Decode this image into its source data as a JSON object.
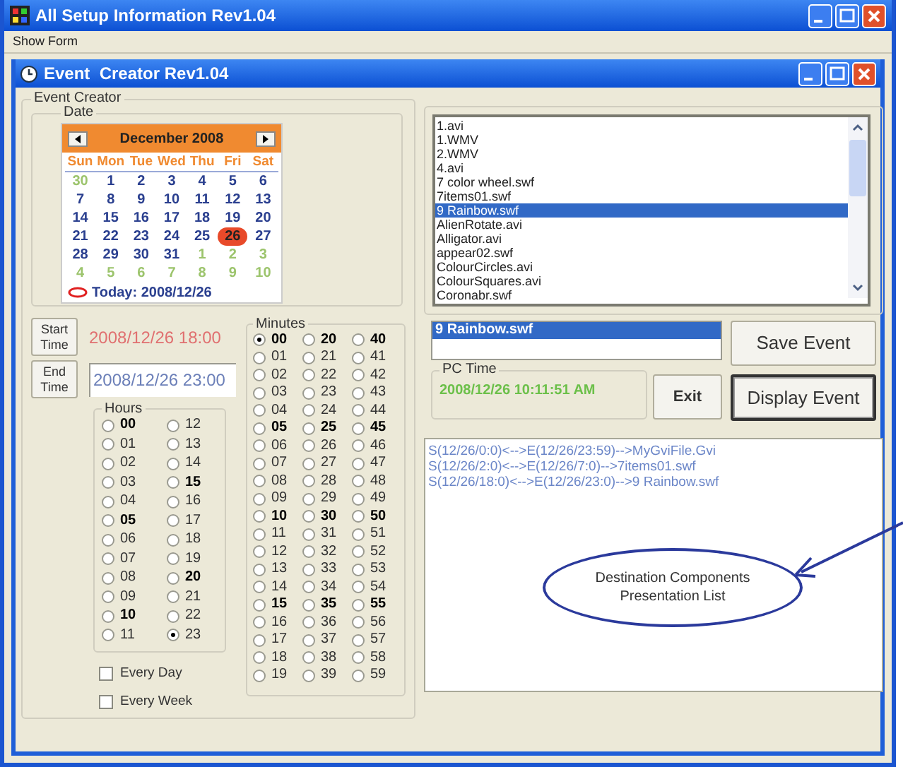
{
  "app_window": {
    "title": "All Setup Information Rev1.04",
    "menu": [
      {
        "label": "Show Form"
      }
    ]
  },
  "event_window": {
    "title": "Event  Creator Rev1.04"
  },
  "event_creator": {
    "legend": "Event Creator",
    "date_legend": "Date",
    "calendar": {
      "month": "December 2008",
      "weekdays": [
        "Sun",
        "Mon",
        "Tue",
        "Wed",
        "Thu",
        "Fri",
        "Sat"
      ],
      "weeks": [
        [
          {
            "day": "30",
            "kind": "other",
            "selected": false
          },
          {
            "day": "1",
            "kind": "current",
            "selected": false
          },
          {
            "day": "2",
            "kind": "current",
            "selected": false
          },
          {
            "day": "3",
            "kind": "current",
            "selected": false
          },
          {
            "day": "4",
            "kind": "current",
            "selected": false
          },
          {
            "day": "5",
            "kind": "current",
            "selected": false
          },
          {
            "day": "6",
            "kind": "current",
            "selected": false
          }
        ],
        [
          {
            "day": "7",
            "kind": "current",
            "selected": false
          },
          {
            "day": "8",
            "kind": "current",
            "selected": false
          },
          {
            "day": "9",
            "kind": "current",
            "selected": false
          },
          {
            "day": "10",
            "kind": "current",
            "selected": false
          },
          {
            "day": "11",
            "kind": "current",
            "selected": false
          },
          {
            "day": "12",
            "kind": "current",
            "selected": false
          },
          {
            "day": "13",
            "kind": "current",
            "selected": false
          }
        ],
        [
          {
            "day": "14",
            "kind": "current",
            "selected": false
          },
          {
            "day": "15",
            "kind": "current",
            "selected": false
          },
          {
            "day": "16",
            "kind": "current",
            "selected": false
          },
          {
            "day": "17",
            "kind": "current",
            "selected": false
          },
          {
            "day": "18",
            "kind": "current",
            "selected": false
          },
          {
            "day": "19",
            "kind": "current",
            "selected": false
          },
          {
            "day": "20",
            "kind": "current",
            "selected": false
          }
        ],
        [
          {
            "day": "21",
            "kind": "current",
            "selected": false
          },
          {
            "day": "22",
            "kind": "current",
            "selected": false
          },
          {
            "day": "23",
            "kind": "current",
            "selected": false
          },
          {
            "day": "24",
            "kind": "current",
            "selected": false
          },
          {
            "day": "25",
            "kind": "current",
            "selected": false
          },
          {
            "day": "26",
            "kind": "current",
            "selected": true
          },
          {
            "day": "27",
            "kind": "current",
            "selected": false
          }
        ],
        [
          {
            "day": "28",
            "kind": "current",
            "selected": false
          },
          {
            "day": "29",
            "kind": "current",
            "selected": false
          },
          {
            "day": "30",
            "kind": "current",
            "selected": false
          },
          {
            "day": "31",
            "kind": "current",
            "selected": false
          },
          {
            "day": "1",
            "kind": "other",
            "selected": false
          },
          {
            "day": "2",
            "kind": "other",
            "selected": false
          },
          {
            "day": "3",
            "kind": "other",
            "selected": false
          }
        ],
        [
          {
            "day": "4",
            "kind": "other",
            "selected": false
          },
          {
            "day": "5",
            "kind": "other",
            "selected": false
          },
          {
            "day": "6",
            "kind": "other",
            "selected": false
          },
          {
            "day": "7",
            "kind": "other",
            "selected": false
          },
          {
            "day": "8",
            "kind": "other",
            "selected": false
          },
          {
            "day": "9",
            "kind": "other",
            "selected": false
          },
          {
            "day": "10",
            "kind": "other",
            "selected": false
          }
        ]
      ],
      "today": "Today: 2008/12/26"
    },
    "start_button": "Start Time",
    "start_time": "2008/12/26 18:00",
    "end_button": "End Time",
    "end_time": "2008/12/26 23:00",
    "hours": {
      "legend": "Hours",
      "columns": [
        [
          {
            "label": "00",
            "bold": true,
            "selected": false
          },
          {
            "label": "01",
            "bold": false,
            "selected": false
          },
          {
            "label": "02",
            "bold": false,
            "selected": false
          },
          {
            "label": "03",
            "bold": false,
            "selected": false
          },
          {
            "label": "04",
            "bold": false,
            "selected": false
          },
          {
            "label": "05",
            "bold": true,
            "selected": false
          },
          {
            "label": "06",
            "bold": false,
            "selected": false
          },
          {
            "label": "07",
            "bold": false,
            "selected": false
          },
          {
            "label": "08",
            "bold": false,
            "selected": false
          },
          {
            "label": "09",
            "bold": false,
            "selected": false
          },
          {
            "label": "10",
            "bold": true,
            "selected": false
          },
          {
            "label": "11",
            "bold": false,
            "selected": false
          }
        ],
        [
          {
            "label": "12",
            "bold": false,
            "selected": false
          },
          {
            "label": "13",
            "bold": false,
            "selected": false
          },
          {
            "label": "14",
            "bold": false,
            "selected": false
          },
          {
            "label": "15",
            "bold": true,
            "selected": false
          },
          {
            "label": "16",
            "bold": false,
            "selected": false
          },
          {
            "label": "17",
            "bold": false,
            "selected": false
          },
          {
            "label": "18",
            "bold": false,
            "selected": false
          },
          {
            "label": "19",
            "bold": false,
            "selected": false
          },
          {
            "label": "20",
            "bold": true,
            "selected": false
          },
          {
            "label": "21",
            "bold": false,
            "selected": false
          },
          {
            "label": "22",
            "bold": false,
            "selected": false
          },
          {
            "label": "23",
            "bold": false,
            "selected": true
          }
        ]
      ]
    },
    "checkboxes": [
      {
        "label": "Every Day",
        "checked": false
      },
      {
        "label": "Every Week",
        "checked": false
      }
    ],
    "minutes": {
      "legend": "Minutes",
      "columns": [
        [
          {
            "label": "00",
            "bold": true,
            "selected": true
          },
          {
            "label": "01",
            "bold": false,
            "selected": false
          },
          {
            "label": "02",
            "bold": false,
            "selected": false
          },
          {
            "label": "03",
            "bold": false,
            "selected": false
          },
          {
            "label": "04",
            "bold": false,
            "selected": false
          },
          {
            "label": "05",
            "bold": true,
            "selected": false
          },
          {
            "label": "06",
            "bold": false,
            "selected": false
          },
          {
            "label": "07",
            "bold": false,
            "selected": false
          },
          {
            "label": "08",
            "bold": false,
            "selected": false
          },
          {
            "label": "09",
            "bold": false,
            "selected": false
          },
          {
            "label": "10",
            "bold": true,
            "selected": false
          },
          {
            "label": "11",
            "bold": false,
            "selected": false
          },
          {
            "label": "12",
            "bold": false,
            "selected": false
          },
          {
            "label": "13",
            "bold": false,
            "selected": false
          },
          {
            "label": "14",
            "bold": false,
            "selected": false
          },
          {
            "label": "15",
            "bold": true,
            "selected": false
          },
          {
            "label": "16",
            "bold": false,
            "selected": false
          },
          {
            "label": "17",
            "bold": false,
            "selected": false
          },
          {
            "label": "18",
            "bold": false,
            "selected": false
          },
          {
            "label": "19",
            "bold": false,
            "selected": false
          }
        ],
        [
          {
            "label": "20",
            "bold": true,
            "selected": false
          },
          {
            "label": "21",
            "bold": false,
            "selected": false
          },
          {
            "label": "22",
            "bold": false,
            "selected": false
          },
          {
            "label": "23",
            "bold": false,
            "selected": false
          },
          {
            "label": "24",
            "bold": false,
            "selected": false
          },
          {
            "label": "25",
            "bold": true,
            "selected": false
          },
          {
            "label": "26",
            "bold": false,
            "selected": false
          },
          {
            "label": "27",
            "bold": false,
            "selected": false
          },
          {
            "label": "28",
            "bold": false,
            "selected": false
          },
          {
            "label": "29",
            "bold": false,
            "selected": false
          },
          {
            "label": "30",
            "bold": true,
            "selected": false
          },
          {
            "label": "31",
            "bold": false,
            "selected": false
          },
          {
            "label": "32",
            "bold": false,
            "selected": false
          },
          {
            "label": "33",
            "bold": false,
            "selected": false
          },
          {
            "label": "34",
            "bold": false,
            "selected": false
          },
          {
            "label": "35",
            "bold": true,
            "selected": false
          },
          {
            "label": "36",
            "bold": false,
            "selected": false
          },
          {
            "label": "37",
            "bold": false,
            "selected": false
          },
          {
            "label": "38",
            "bold": false,
            "selected": false
          },
          {
            "label": "39",
            "bold": false,
            "selected": false
          }
        ],
        [
          {
            "label": "40",
            "bold": true,
            "selected": false
          },
          {
            "label": "41",
            "bold": false,
            "selected": false
          },
          {
            "label": "42",
            "bold": false,
            "selected": false
          },
          {
            "label": "43",
            "bold": false,
            "selected": false
          },
          {
            "label": "44",
            "bold": false,
            "selected": false
          },
          {
            "label": "45",
            "bold": true,
            "selected": false
          },
          {
            "label": "46",
            "bold": false,
            "selected": false
          },
          {
            "label": "47",
            "bold": false,
            "selected": false
          },
          {
            "label": "48",
            "bold": false,
            "selected": false
          },
          {
            "label": "49",
            "bold": false,
            "selected": false
          },
          {
            "label": "50",
            "bold": true,
            "selected": false
          },
          {
            "label": "51",
            "bold": false,
            "selected": false
          },
          {
            "label": "52",
            "bold": false,
            "selected": false
          },
          {
            "label": "53",
            "bold": false,
            "selected": false
          },
          {
            "label": "54",
            "bold": false,
            "selected": false
          },
          {
            "label": "55",
            "bold": true,
            "selected": false
          },
          {
            "label": "56",
            "bold": false,
            "selected": false
          },
          {
            "label": "57",
            "bold": false,
            "selected": false
          },
          {
            "label": "58",
            "bold": false,
            "selected": false
          },
          {
            "label": "59",
            "bold": false,
            "selected": false
          }
        ]
      ]
    }
  },
  "files": {
    "items": [
      {
        "label": "1.avi",
        "selected": false
      },
      {
        "label": "1.WMV",
        "selected": false
      },
      {
        "label": "2.WMV",
        "selected": false
      },
      {
        "label": "4.avi",
        "selected": false
      },
      {
        "label": "7 color wheel.swf",
        "selected": false
      },
      {
        "label": "7items01.swf",
        "selected": false
      },
      {
        "label": "9 Rainbow.swf",
        "selected": true
      },
      {
        "label": "AlienRotate.avi",
        "selected": false
      },
      {
        "label": "Alligator.avi",
        "selected": false
      },
      {
        "label": "appear02.swf",
        "selected": false
      },
      {
        "label": "ColourCircles.avi",
        "selected": false
      },
      {
        "label": "ColourSquares.avi",
        "selected": false
      },
      {
        "label": "Coronabr.swf",
        "selected": false
      }
    ]
  },
  "selected_file": "9 Rainbow.swf",
  "pc_time": {
    "legend": "PC Time",
    "value": "2008/12/26 10:11:51 AM"
  },
  "buttons": [
    {
      "label": "Save Event",
      "default": false
    },
    {
      "label": "Exit",
      "default": false
    },
    {
      "label": "Display Event",
      "default": true
    }
  ],
  "events": [
    "S(12/26/0:0)<-->E(12/26/23:59)-->MyGviFile.Gvi",
    "S(12/26/2:0)<-->E(12/26/7:0)-->7items01.swf",
    "S(12/26/18:0)<-->E(12/26/23:0)-->9 Rainbow.swf"
  ],
  "annotation": {
    "text": "Destination Components Presentation List"
  }
}
